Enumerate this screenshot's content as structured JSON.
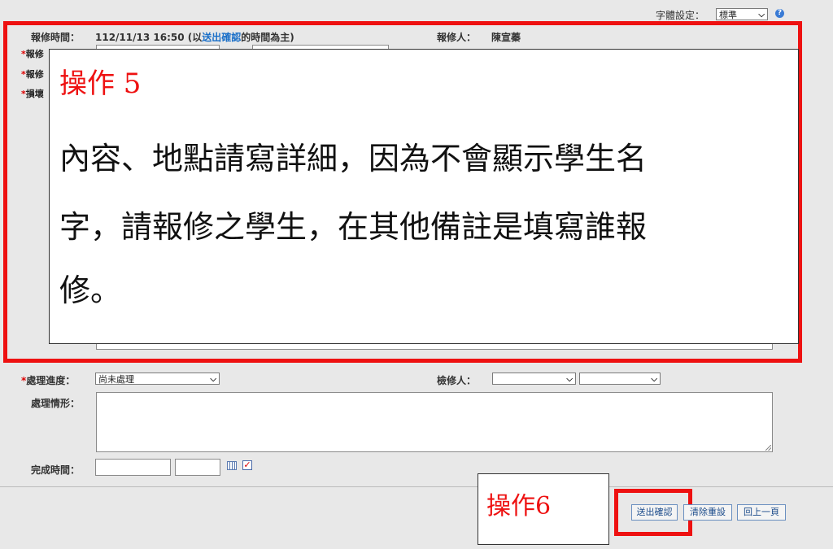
{
  "font_setting": {
    "label": "字體設定：",
    "value": "標準",
    "help_icon": "help-icon"
  },
  "report": {
    "time_label": "報修時間：",
    "time_value": "112/11/13 16:50",
    "time_note_prefix": "(以",
    "time_note_link": "送出確認",
    "time_note_suffix": "的時間為主)",
    "reporter_label": "報修人：",
    "reporter_value": "陳宣蓁",
    "hidden_label_1": "報修",
    "hidden_label_2": "報修",
    "hidden_label_3": "損壞",
    "required_mark": "*"
  },
  "callout5": {
    "title": "操作 5",
    "lines": [
      "內容、地點請寫詳細，因為不會顯示學生名",
      "字，請報修之學生，在其他備註是填寫誰報",
      "修。"
    ]
  },
  "processing": {
    "progress_label": "處理進度：",
    "progress_value": "尚未處理",
    "inspector_label": "檢修人：",
    "inspector_value_1": "",
    "inspector_value_2": "",
    "status_label": "處理情形：",
    "status_value": "",
    "done_label": "完成時間：",
    "done_date": "",
    "done_time": "",
    "calendar_icon": "calendar-icon",
    "check_icon": "checkbox-icon"
  },
  "callout6": {
    "title": "操作6"
  },
  "buttons": {
    "submit": "送出確認",
    "reset": "清除重設",
    "back": "回上一頁"
  },
  "colors": {
    "highlight": "#ee1111",
    "link": "#1a6fc8",
    "background": "#e8e8e8"
  }
}
